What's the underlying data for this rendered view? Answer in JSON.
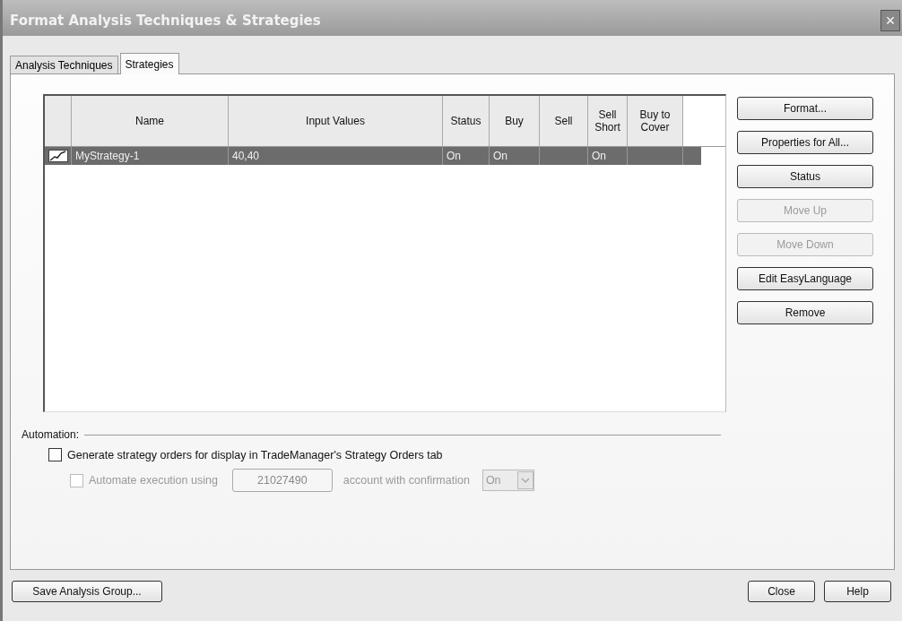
{
  "window": {
    "title": "Format Analysis Techniques & Strategies",
    "close": "×"
  },
  "tabs": [
    {
      "label": "Analysis Techniques",
      "selected": false
    },
    {
      "label": "Strategies",
      "selected": true
    }
  ],
  "table": {
    "columns": [
      "Name",
      "Input Values",
      "Status",
      "Buy",
      "Sell",
      "Sell Short",
      "Buy to Cover"
    ],
    "rows": [
      {
        "selected": true,
        "cells": [
          "MyStrategy-1",
          "40,40",
          "On",
          "On",
          "",
          "On",
          ""
        ]
      }
    ]
  },
  "side_buttons": [
    {
      "label": "Format...",
      "disabled": false
    },
    {
      "label": "Properties for All...",
      "disabled": false
    },
    {
      "label": "Status",
      "disabled": false
    },
    {
      "label": "Move Up",
      "disabled": true
    },
    {
      "label": "Move Down",
      "disabled": true
    },
    {
      "label": "Edit EasyLanguage",
      "disabled": false
    },
    {
      "label": "Remove",
      "disabled": false
    }
  ],
  "automation": {
    "heading": "Automation:",
    "generate": {
      "label": "Generate strategy orders for display in TradeManager's Strategy Orders tab",
      "checked": false,
      "disabled": false
    },
    "automate": {
      "label": "Automate execution using",
      "checked": false,
      "disabled": true
    },
    "account": {
      "value": "21027490"
    },
    "suffix": "account with confirmation",
    "confirmation": {
      "value": "On"
    }
  },
  "footer": {
    "left": [
      "Save Analysis Group..."
    ],
    "right": [
      "Close",
      "Help"
    ]
  }
}
